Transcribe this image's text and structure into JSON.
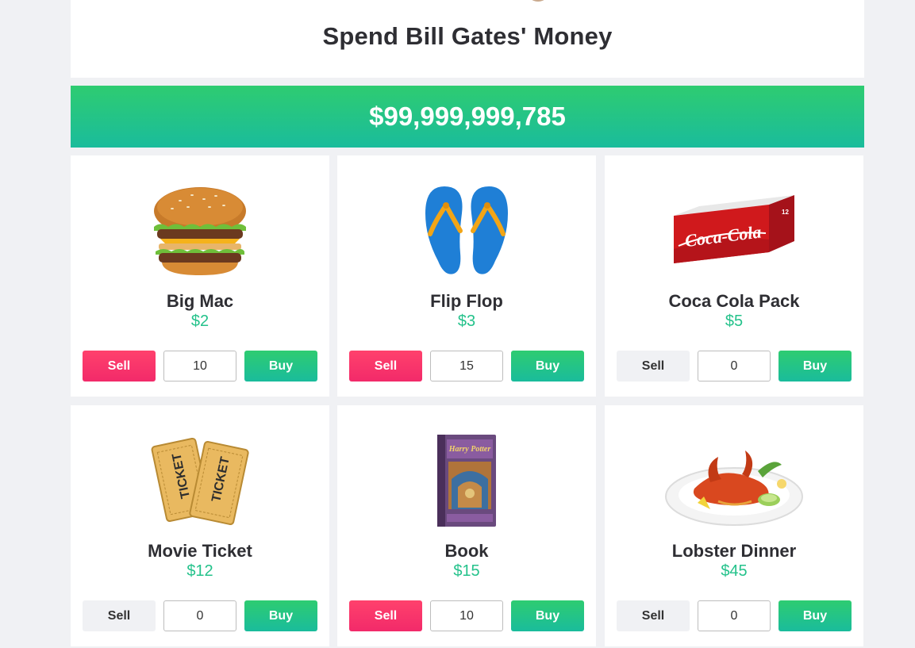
{
  "header": {
    "title": "Spend Bill Gates' Money"
  },
  "balance": "$99,999,999,785",
  "colors": {
    "accent_green": "#2ecc71",
    "accent_teal": "#1abc9c",
    "sell_active": "#ff416c",
    "sell_inactive": "#f0f1f4",
    "price_text": "#24c28b"
  },
  "products": [
    {
      "name": "Big Mac",
      "price": "$2",
      "quantity": "10",
      "sell_label": "Sell",
      "buy_label": "Buy",
      "icon": "burger-icon",
      "sell_enabled": true
    },
    {
      "name": "Flip Flop",
      "price": "$3",
      "quantity": "15",
      "sell_label": "Sell",
      "buy_label": "Buy",
      "icon": "flip-flop-icon",
      "sell_enabled": true
    },
    {
      "name": "Coca Cola Pack",
      "price": "$5",
      "quantity": "0",
      "sell_label": "Sell",
      "buy_label": "Buy",
      "icon": "soda-pack-icon",
      "sell_enabled": false
    },
    {
      "name": "Movie Ticket",
      "price": "$12",
      "quantity": "0",
      "sell_label": "Sell",
      "buy_label": "Buy",
      "icon": "ticket-icon",
      "sell_enabled": false
    },
    {
      "name": "Book",
      "price": "$15",
      "quantity": "10",
      "sell_label": "Sell",
      "buy_label": "Buy",
      "icon": "book-icon",
      "sell_enabled": true
    },
    {
      "name": "Lobster Dinner",
      "price": "$45",
      "quantity": "0",
      "sell_label": "Sell",
      "buy_label": "Buy",
      "icon": "lobster-dinner-icon",
      "sell_enabled": false
    }
  ],
  "artwork_text": {
    "soda_brand": "Coca-Cola",
    "soda_count": "12",
    "ticket_word": "TICKET",
    "book_title": "Harry Potter"
  }
}
